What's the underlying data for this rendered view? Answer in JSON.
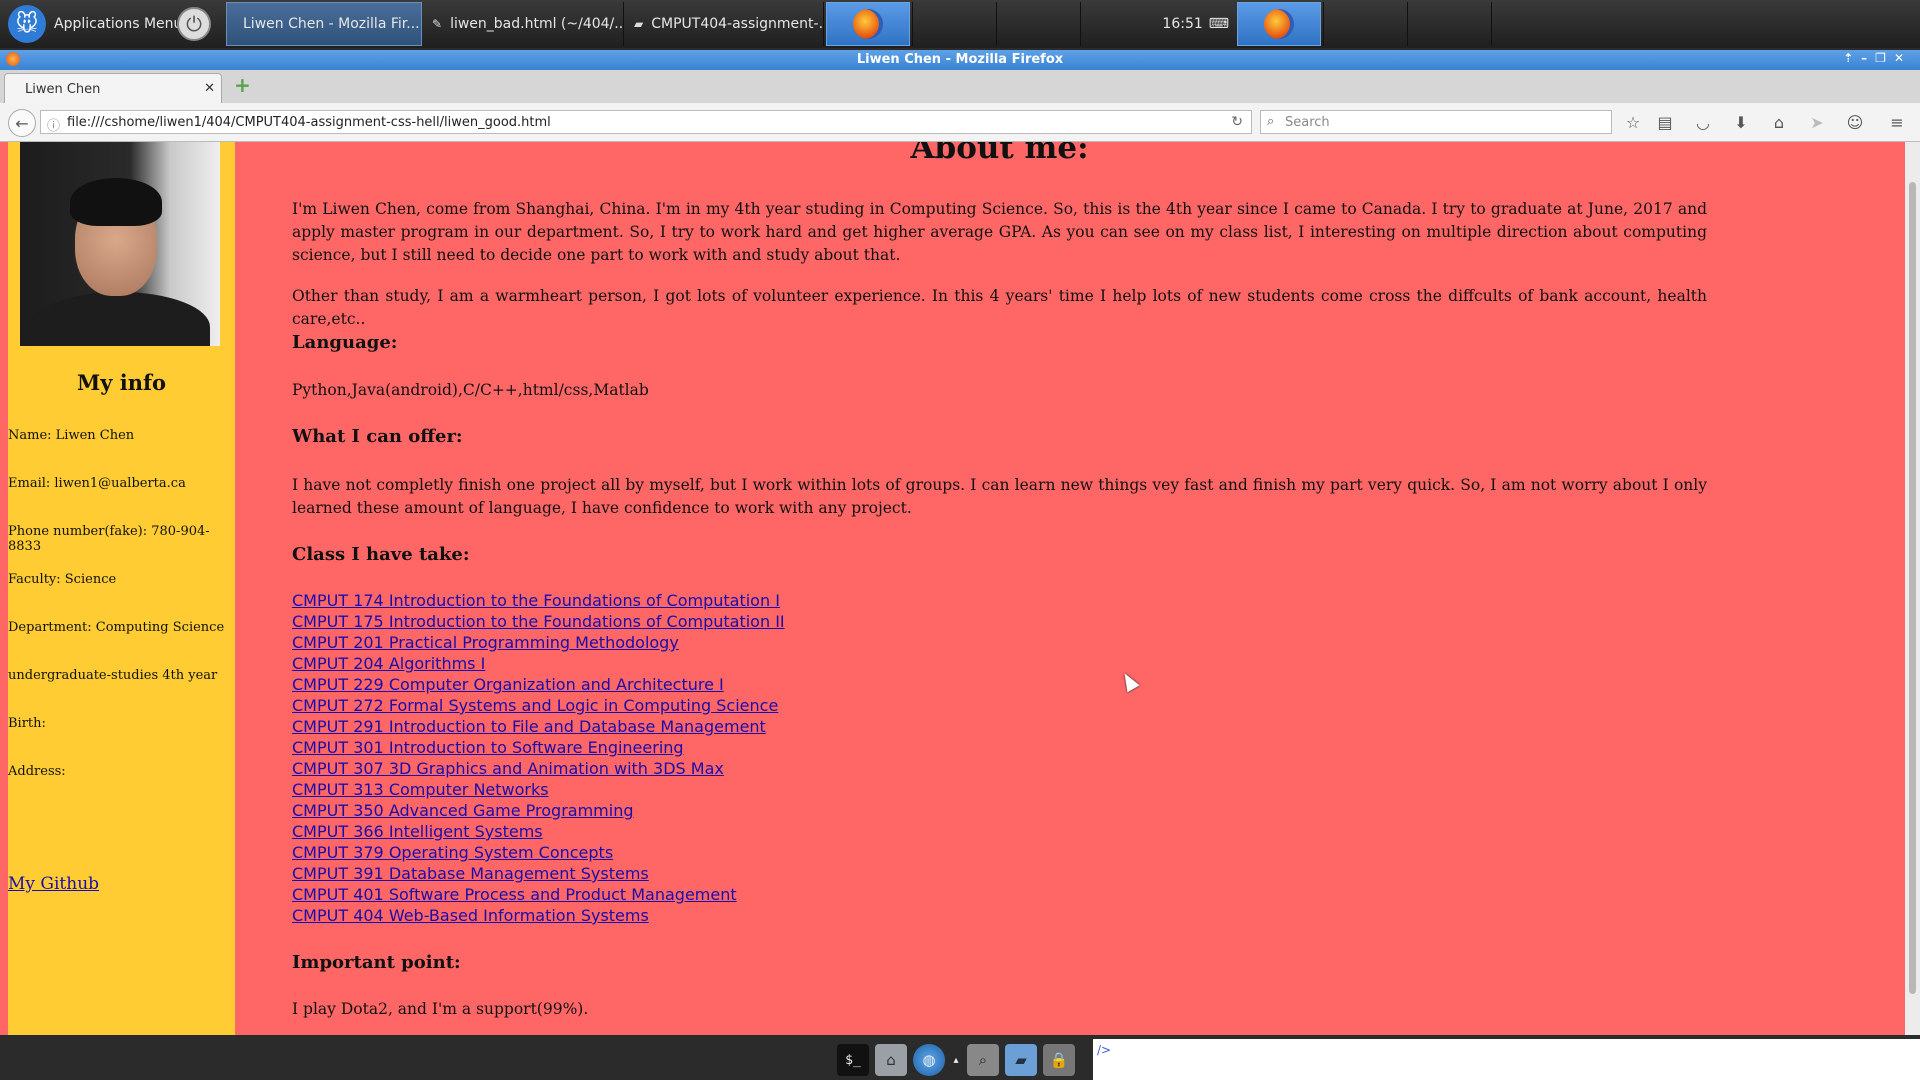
{
  "panel": {
    "app_menu_label": "Applications Menu",
    "tasks": [
      {
        "label": "Liwen Chen - Mozilla Fir...",
        "icon": "firefox-icon"
      },
      {
        "label": "liwen_bad.html (~/404/...",
        "icon": "text-editor-icon"
      },
      {
        "label": "CMPUT404-assignment-...",
        "icon": "folder-icon"
      }
    ],
    "clock": "16:51"
  },
  "browser": {
    "window_title": "Liwen Chen - Mozilla Firefox",
    "tab_title": "Liwen Chen",
    "url": "file:///cshome/liwen1/404/CMPUT404-assignment-css-hell/liwen_good.html",
    "search_placeholder": "Search"
  },
  "sidebar": {
    "title": "My info",
    "lines": [
      "Name: Liwen Chen",
      "Email: liwen1@ualberta.ca",
      "Phone number(fake): 780-904-8833",
      "Faculty: Science",
      "Department: Computing Science",
      "undergraduate-studies 4th year",
      "Birth:",
      "Address:"
    ],
    "github_link": "My Github"
  },
  "main": {
    "heading": "About me:",
    "intro_1": "I'm Liwen Chen, come from Shanghai, China. I'm in my 4th year studing in Computing Science. So, this is the 4th year since I came to Canada. I try to graduate at June, 2017 and apply master program in our department. So, I try to work hard and get higher average GPA. As you can see on my class list, I interesting on multiple direction about computing science, but I still need to decide one part to work with and study about that.",
    "intro_2": "Other than study, I am a warmheart person, I got lots of volunteer experience. In this 4 years' time I help lots of new students come cross the diffcults of bank account, health care,etc..",
    "language_heading": "Language:",
    "language_text": "Python,Java(android),C/C++,html/css,Matlab",
    "offer_heading": "What I can offer:",
    "offer_text": "I have not completly finish one project all by myself, but I work within lots of groups. I can learn new things vey fast and finish my part very quick. So, I am not worry about I only learned these amount of language, I have confidence to work with any project.",
    "classes_heading": "Class I have take:",
    "classes": [
      "CMPUT 174 Introduction to the Foundations of Computation I",
      "CMPUT 175 Introduction to the Foundations of Computation II",
      "CMPUT 201 Practical Programming Methodology",
      "CMPUT 204 Algorithms I",
      "CMPUT 229 Computer Organization and Architecture I",
      "CMPUT 272 Formal Systems and Logic in Computing Science",
      "CMPUT 291 Introduction to File and Database Management",
      "CMPUT 301 Introduction to Software Engineering",
      "CMPUT 307 3D Graphics and Animation with 3DS Max",
      "CMPUT 313 Computer Networks",
      "CMPUT 350 Advanced Game Programming",
      "CMPUT 366 Intelligent Systems",
      "CMPUT 379 Operating System Concepts",
      "CMPUT 391 Database Management Systems",
      "CMPUT 401 Software Process and Product Management",
      "CMPUT 404 Web-Based Information Systems"
    ],
    "important_heading": "Important point:",
    "important_text": "I play Dota2, and I'm a support(99%)."
  },
  "bottom": {
    "field_text": "/>"
  },
  "colors": {
    "page_background": "#ff6666",
    "sidebar_background": "#ffcc33",
    "link": "#1a0dab"
  }
}
